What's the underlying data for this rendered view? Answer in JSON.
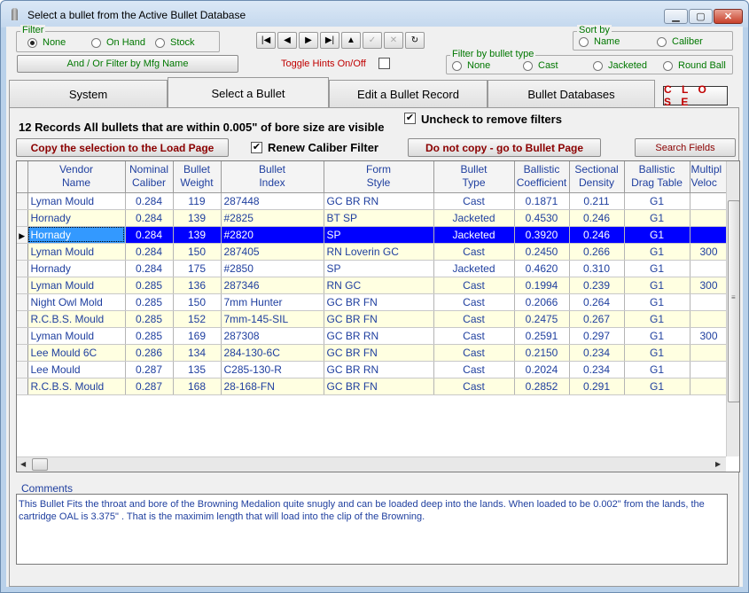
{
  "window": {
    "title": "Select a bullet from the Active Bullet Database"
  },
  "filter": {
    "caption": "Filter",
    "options": [
      "None",
      "On Hand",
      "Stock"
    ],
    "selected": "None",
    "mfg_button": "And / Or Filter by Mfg Name"
  },
  "toggle_hints_label": "Toggle Hints On/Off",
  "sort_by": {
    "caption": "Sort by",
    "options": [
      "Name",
      "Caliber"
    ]
  },
  "filter_type": {
    "caption": "Filter by bullet type",
    "options": [
      "None",
      "Cast",
      "Jacketed",
      "Round Ball"
    ]
  },
  "tabs": [
    {
      "label": "System"
    },
    {
      "label": "Select a Bullet"
    },
    {
      "label": "Edit a Bullet Record"
    },
    {
      "label": "Bullet Databases"
    }
  ],
  "close_label": "C L O S E",
  "records_text": "12 Records All bullets that are within 0.005\" of bore size are visible",
  "uncheck_label": "Uncheck to remove filters",
  "renew_label": "Renew Caliber Filter",
  "copy_button": "Copy the selection to the Load Page",
  "nocopy_button": "Do not copy - go to Bullet Page",
  "search_button": "Search Fields",
  "grid": {
    "columns": [
      {
        "l1": "Vendor",
        "l2": "Name"
      },
      {
        "l1": "Nominal",
        "l2": "Caliber"
      },
      {
        "l1": "Bullet",
        "l2": "Weight"
      },
      {
        "l1": "Bullet",
        "l2": "Index"
      },
      {
        "l1": "Form",
        "l2": "Style"
      },
      {
        "l1": "Bullet",
        "l2": "Type"
      },
      {
        "l1": "Ballistic",
        "l2": "Coefficient"
      },
      {
        "l1": "Sectional",
        "l2": "Density"
      },
      {
        "l1": "Ballistic",
        "l2": "Drag Table"
      },
      {
        "l1": "Multipl",
        "l2": "Veloc"
      }
    ],
    "rows": [
      {
        "vendor": "Lyman Mould",
        "caliber": "0.284",
        "weight": "119",
        "index": "287448",
        "form": "GC BR RN",
        "type": "Cast",
        "bc": "0.1871",
        "sd": "0.211",
        "drag": "G1",
        "mv": ""
      },
      {
        "vendor": "Hornady",
        "caliber": "0.284",
        "weight": "139",
        "index": "#2825",
        "form": "BT SP",
        "type": "Jacketed",
        "bc": "0.4530",
        "sd": "0.246",
        "drag": "G1",
        "mv": ""
      },
      {
        "vendor": "Hornady",
        "caliber": "0.284",
        "weight": "139",
        "index": "#2820",
        "form": "SP",
        "type": "Jacketed",
        "bc": "0.3920",
        "sd": "0.246",
        "drag": "G1",
        "mv": ""
      },
      {
        "vendor": "Lyman Mould",
        "caliber": "0.284",
        "weight": "150",
        "index": "287405",
        "form": "RN Loverin GC",
        "type": "Cast",
        "bc": "0.2450",
        "sd": "0.266",
        "drag": "G1",
        "mv": "300"
      },
      {
        "vendor": "Hornady",
        "caliber": "0.284",
        "weight": "175",
        "index": "#2850",
        "form": "SP",
        "type": "Jacketed",
        "bc": "0.4620",
        "sd": "0.310",
        "drag": "G1",
        "mv": ""
      },
      {
        "vendor": "Lyman Mould",
        "caliber": "0.285",
        "weight": "136",
        "index": "287346",
        "form": "RN GC",
        "type": "Cast",
        "bc": "0.1994",
        "sd": "0.239",
        "drag": "G1",
        "mv": "300"
      },
      {
        "vendor": "Night Owl Mold",
        "caliber": "0.285",
        "weight": "150",
        "index": "7mm Hunter",
        "form": "GC BR FN",
        "type": "Cast",
        "bc": "0.2066",
        "sd": "0.264",
        "drag": "G1",
        "mv": ""
      },
      {
        "vendor": "R.C.B.S. Mould",
        "caliber": "0.285",
        "weight": "152",
        "index": "7mm-145-SIL",
        "form": "GC BR FN",
        "type": "Cast",
        "bc": "0.2475",
        "sd": "0.267",
        "drag": "G1",
        "mv": ""
      },
      {
        "vendor": "Lyman Mould",
        "caliber": "0.285",
        "weight": "169",
        "index": "287308",
        "form": "GC BR RN",
        "type": "Cast",
        "bc": "0.2591",
        "sd": "0.297",
        "drag": "G1",
        "mv": "300"
      },
      {
        "vendor": "Lee Mould 6C",
        "caliber": "0.286",
        "weight": "134",
        "index": "284-130-6C",
        "form": "GC BR FN",
        "type": "Cast",
        "bc": "0.2150",
        "sd": "0.234",
        "drag": "G1",
        "mv": ""
      },
      {
        "vendor": "Lee Mould",
        "caliber": "0.287",
        "weight": "135",
        "index": "C285-130-R",
        "form": "GC BR RN",
        "type": "Cast",
        "bc": "0.2024",
        "sd": "0.234",
        "drag": "G1",
        "mv": ""
      },
      {
        "vendor": "R.C.B.S. Mould",
        "caliber": "0.287",
        "weight": "168",
        "index": "28-168-FN",
        "form": "GC BR FN",
        "type": "Cast",
        "bc": "0.2852",
        "sd": "0.291",
        "drag": "G1",
        "mv": ""
      }
    ]
  },
  "comments": {
    "label": "Comments",
    "text": "This Bullet Fits the throat and bore of the Browning Medalion quite snugly and can be loaded deep into the lands.  When loaded to be 0.002\" from the lands, the cartridge OAL is 3.375\" . That is the maximim length that will load into the clip of the Browning."
  },
  "colors": {
    "accent_green": "#007700",
    "grid_text": "#1f3f9f",
    "row_alt": "#ffffe1",
    "selection": "#0000ff",
    "close_red": "#c00000"
  }
}
